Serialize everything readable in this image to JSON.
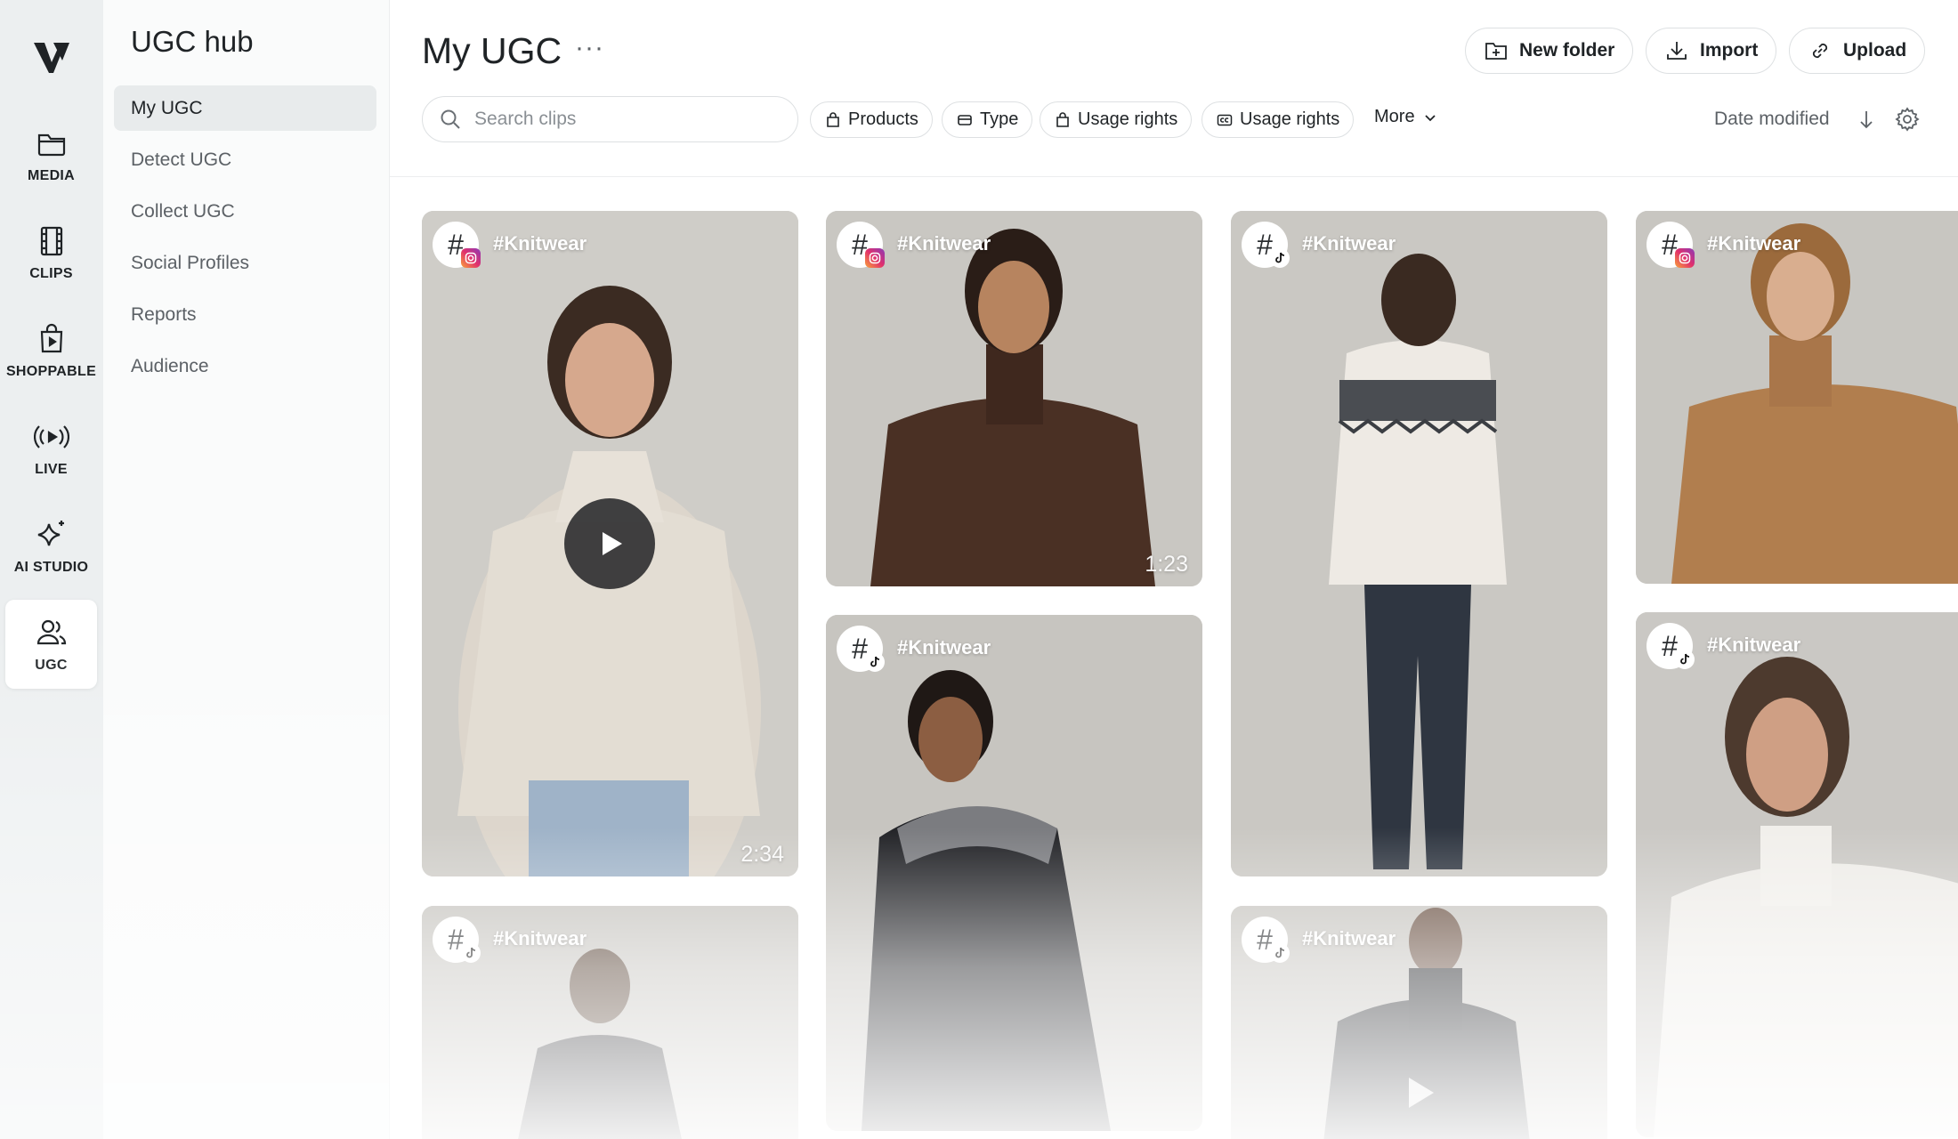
{
  "rail": {
    "items": [
      {
        "label": "MEDIA",
        "icon": "folder-icon"
      },
      {
        "label": "CLIPS",
        "icon": "film-icon"
      },
      {
        "label": "SHOPPABLE",
        "icon": "shopping-bag-play-icon"
      },
      {
        "label": "LIVE",
        "icon": "broadcast-icon"
      },
      {
        "label": "AI STUDIO",
        "icon": "sparkle-icon"
      },
      {
        "label": "UGC",
        "icon": "users-icon",
        "active": true
      }
    ]
  },
  "sidebar": {
    "title": "UGC hub",
    "items": [
      {
        "label": "My UGC",
        "active": true
      },
      {
        "label": "Detect UGC"
      },
      {
        "label": "Collect UGC"
      },
      {
        "label": "Social Profiles"
      },
      {
        "label": "Reports"
      },
      {
        "label": "Audience"
      }
    ]
  },
  "header": {
    "title": "My UGC",
    "more_glyph": "···",
    "new_folder_label": "New folder",
    "import_label": "Import",
    "upload_label": "Upload"
  },
  "toolbar": {
    "search_placeholder": "Search clips",
    "filters": [
      {
        "label": "Products",
        "icon": "bag-icon"
      },
      {
        "label": "Type",
        "icon": "card-icon"
      },
      {
        "label": "Usage rights",
        "icon": "bag-icon"
      },
      {
        "label": "Usage rights",
        "icon": "cc-icon"
      }
    ],
    "more_label": "More",
    "sort_label": "Date modified"
  },
  "cards": [
    {
      "tag": "#Knitwear",
      "platform": "instagram",
      "duration": "2:34",
      "has_play": true,
      "tone": "oatmeal"
    },
    {
      "tag": "#Knitwear",
      "platform": "instagram",
      "duration": "1:23",
      "has_play": false,
      "tone": "brown"
    },
    {
      "tag": "#Knitwear",
      "platform": "tiktok",
      "duration": "",
      "has_play": false,
      "tone": "fairisle"
    },
    {
      "tag": "#Knitwear",
      "platform": "instagram",
      "duration": "",
      "has_play": false,
      "tone": "camel"
    },
    {
      "tag": "#Knitwear",
      "platform": "tiktok",
      "duration": "",
      "has_play": false,
      "tone": "coat"
    },
    {
      "tag": "#Knitwear",
      "platform": "tiktok",
      "duration": "",
      "has_play": false,
      "tone": "black-fairisle"
    },
    {
      "tag": "#Knitwear",
      "platform": "tiktok",
      "duration": "",
      "has_play": true,
      "tone": "black-turtleneck"
    },
    {
      "tag": "#Knitwear",
      "platform": "tiktok",
      "duration": "",
      "has_play": false,
      "tone": "white"
    }
  ],
  "colors": {
    "rail_bg": "#eceff0",
    "sidebar_bg": "#fafbfb",
    "active_item_bg": "#e8ebec",
    "text_primary": "#1f2326",
    "text_secondary": "#5c6166",
    "border": "#dde0e2"
  }
}
